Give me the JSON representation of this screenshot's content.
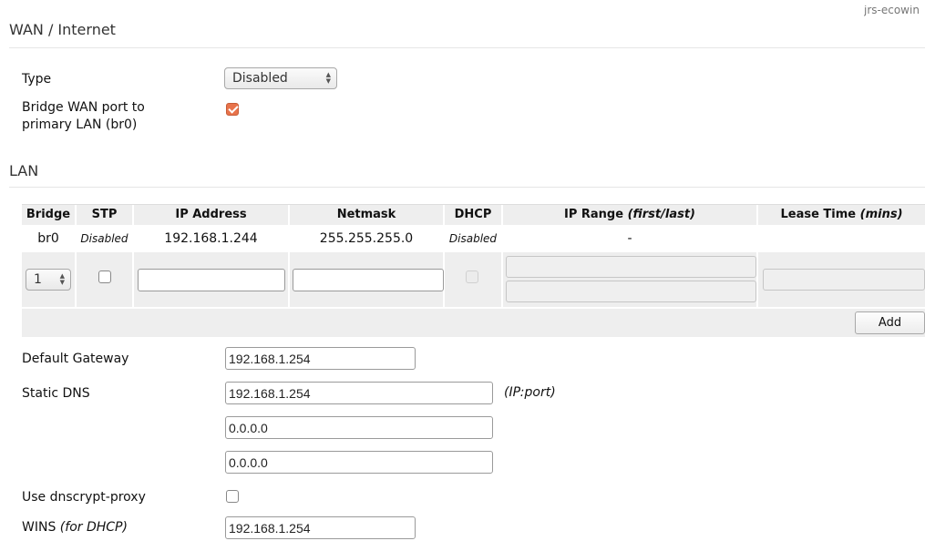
{
  "corner_text": "jrs-ecowin",
  "wan": {
    "title": "WAN / Internet",
    "type_label": "Type",
    "type_value": "Disabled",
    "bridge_label_line1": "Bridge WAN port to",
    "bridge_label_line2": "primary LAN (br0)",
    "bridge_checked": true
  },
  "lan": {
    "title": "LAN",
    "table": {
      "headers": {
        "bridge": "Bridge",
        "stp": "STP",
        "ip_address": "IP Address",
        "netmask": "Netmask",
        "dhcp": "DHCP",
        "ip_range": "IP Range",
        "ip_range_suffix": "(first/last)",
        "lease_time": "Lease Time",
        "lease_time_suffix": "(mins)"
      },
      "rows": [
        {
          "bridge": "br0",
          "stp": "Disabled",
          "ip_address": "192.168.1.244",
          "netmask": "255.255.255.0",
          "dhcp": "Disabled",
          "ip_range": "-",
          "lease_time": ""
        }
      ],
      "new_row": {
        "bridge_select": "1",
        "ip_address": "",
        "netmask": "",
        "range_first": "",
        "range_last": "",
        "lease_time": ""
      },
      "add_button": "Add"
    }
  },
  "network": {
    "default_gateway_label": "Default Gateway",
    "default_gateway": "192.168.1.254",
    "static_dns_label": "Static DNS",
    "dns1": "192.168.1.254",
    "dns2": "0.0.0.0",
    "dns3": "0.0.0.0",
    "dns_hint": "(IP:port)",
    "dnscrypt_label": "Use dnscrypt-proxy",
    "dnscrypt_checked": false,
    "wins_label": "WINS",
    "wins_label_suffix": "(for DHCP)",
    "wins": "192.168.1.254"
  },
  "colors": {
    "checkbox_checked": "#e8734b",
    "table_header_bg": "#eeeeee",
    "table_footer_bg": "#eeeeee"
  }
}
